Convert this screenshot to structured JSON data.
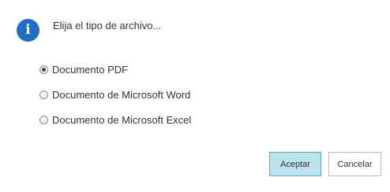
{
  "dialog": {
    "icon": "info-icon",
    "message": "Elija el tipo de archivo..."
  },
  "options": [
    {
      "label": "Documento PDF",
      "checked": true
    },
    {
      "label": "Documento de Microsoft Word",
      "checked": false
    },
    {
      "label": "Documento de Microsoft Excel",
      "checked": false
    }
  ],
  "buttons": {
    "accept_label": "Aceptar",
    "cancel_label": "Cancelar"
  },
  "colors": {
    "info_icon": "#1f6fc5",
    "accept_bg": "#bde3ea",
    "accept_border": "#5aa8d8"
  }
}
